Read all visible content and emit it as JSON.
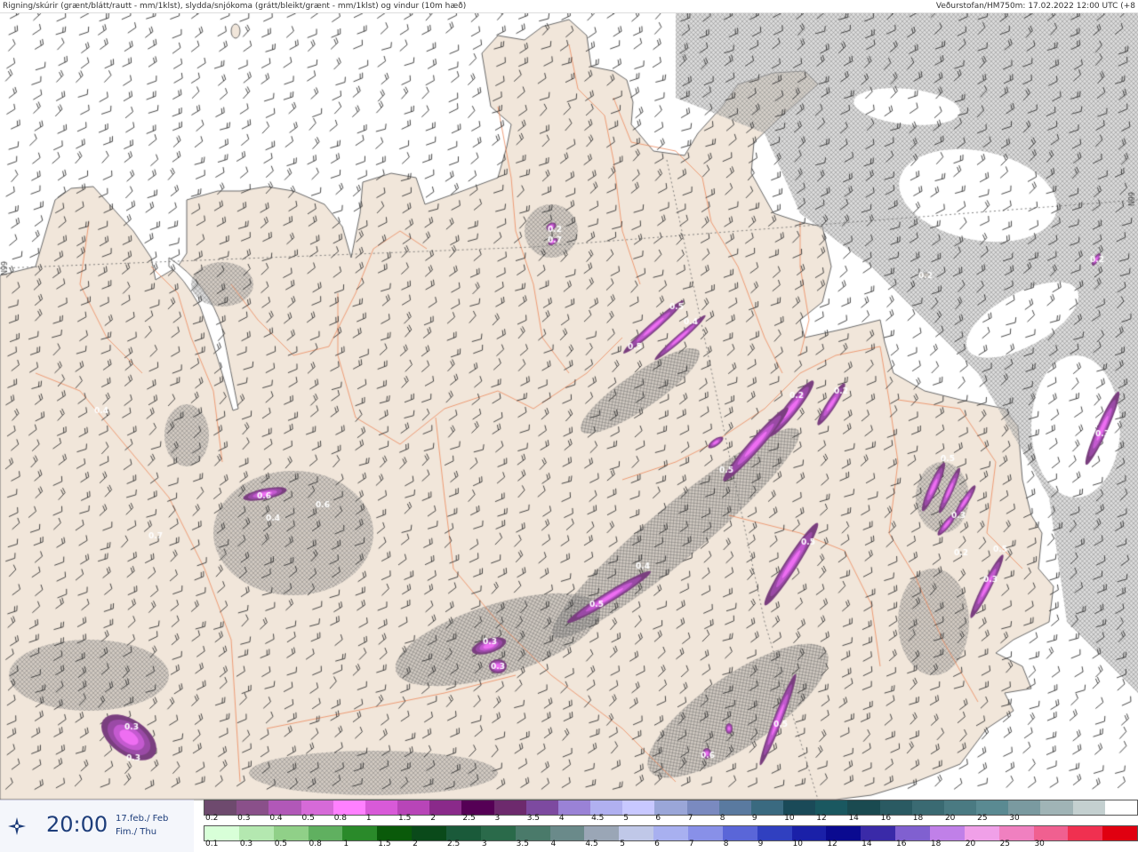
{
  "header": {
    "left": "Rigning/skúrir (grænt/blátt/rautt - mm/1klst), slydda/snjókoma (grátt/bleikt/grænt - mm/1klst) og vindur (10m hæð)",
    "right": "Veðurstofan/HM750m: 17.02.2022 12:00 UTC (+8"
  },
  "map": {
    "land_color": "#f1e6da",
    "sea_color": "#ffffff",
    "road_color": "#ee8a5c",
    "hatch_color": "#555555",
    "snow_colors": [
      "#7a3f7f",
      "#9a4aa6",
      "#c45ad0",
      "#ee6ef2"
    ],
    "gridline_labels": [
      "N99",
      "N99"
    ],
    "precip_labels": [
      "0.5",
      "0.4",
      "0.5",
      "0.2",
      "0.2",
      "0.5",
      "0.5",
      "0.4",
      "0.5",
      "0.6",
      "0.4",
      "0.7",
      "0.3",
      "0.3",
      "0.3",
      "0.3",
      "0.3",
      "0.5",
      "0.3",
      "0.2",
      "0.3",
      "0.5",
      "0.5",
      "0.6",
      "0.4",
      "0.6",
      "0.2",
      "0.7",
      "0.2",
      "0.2"
    ]
  },
  "time": {
    "value": "20:00",
    "date_line1": "17.feb./ Feb",
    "date_line2": "Fim./ Thu"
  },
  "legend": {
    "snow_colors": [
      "#6e4a6e",
      "#8a508a",
      "#b158b8",
      "#d66ad8",
      "#ff80ff",
      "#d85ad8",
      "#b845b8",
      "#8a2a8a",
      "#550055",
      "#6d2a6d",
      "#7d4aa0",
      "#9a82d6",
      "#b0b0f0",
      "#c8c8ff",
      "#9aa6d8",
      "#7a8ac0",
      "#5a7aa0",
      "#3a6a80",
      "#1a4a58",
      "#1a5860",
      "#1a4a50",
      "#2a5a62",
      "#3a6a72",
      "#4a7a82",
      "#5a8a92",
      "#7a9aa0",
      "#a0b4b6",
      "#c4d0d0",
      "#ffffff"
    ],
    "snow_labels": [
      "0.2",
      "0.3",
      "0.4",
      "0.5",
      "0.8",
      "1",
      "1.5",
      "2",
      "2.5",
      "3",
      "3.5",
      "4",
      "4.5",
      "5",
      "6",
      "7",
      "8",
      "9",
      "10",
      "12",
      "14",
      "16",
      "18",
      "20",
      "25",
      "30"
    ],
    "rain_colors": [
      "#d8ffd8",
      "#b4e8b0",
      "#90d088",
      "#60b060",
      "#2a8a2a",
      "#0a5a0a",
      "#0a4a1a",
      "#1a5a3a",
      "#2a6a4a",
      "#4a7a6a",
      "#6a8a8a",
      "#9aa6b6",
      "#c0c8e8",
      "#a8b0f0",
      "#8890e8",
      "#5a66d8",
      "#3040c0",
      "#1a20a8",
      "#0a0a90",
      "#3a2aa8",
      "#8060d0",
      "#c080e8",
      "#f0a0e8",
      "#f080c0",
      "#f06090",
      "#f03050",
      "#e00010"
    ],
    "rain_labels": [
      "0.1",
      "0.3",
      "0.5",
      "0.8",
      "1",
      "1.5",
      "2",
      "2.5",
      "3",
      "3.5",
      "4",
      "4.5",
      "5",
      "6",
      "7",
      "8",
      "9",
      "10",
      "12",
      "14",
      "16",
      "18",
      "20",
      "25",
      "30"
    ]
  }
}
